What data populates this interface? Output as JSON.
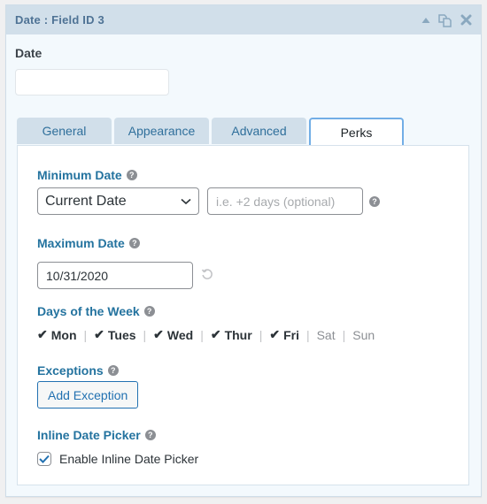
{
  "header": {
    "title": "Date : Field ID 3",
    "icons": [
      "collapse-triangle-icon",
      "duplicate-icon",
      "close-icon"
    ]
  },
  "field": {
    "label": "Date",
    "preview_value": ""
  },
  "tabs": [
    {
      "label": "General",
      "active": false
    },
    {
      "label": "Appearance",
      "active": false
    },
    {
      "label": "Advanced",
      "active": false
    },
    {
      "label": "Perks",
      "active": true
    }
  ],
  "perks": {
    "minimum_date": {
      "label": "Minimum Date",
      "select_value": "Current Date",
      "offset_value": "",
      "offset_placeholder": "i.e. +2 days (optional)"
    },
    "maximum_date": {
      "label": "Maximum Date",
      "value": "10/31/2020"
    },
    "days_of_week": {
      "label": "Days of the Week",
      "days": [
        {
          "label": "Mon",
          "enabled": true
        },
        {
          "label": "Tues",
          "enabled": true
        },
        {
          "label": "Wed",
          "enabled": true
        },
        {
          "label": "Thur",
          "enabled": true
        },
        {
          "label": "Fri",
          "enabled": true
        },
        {
          "label": "Sat",
          "enabled": false
        },
        {
          "label": "Sun",
          "enabled": false
        }
      ]
    },
    "exceptions": {
      "label": "Exceptions",
      "button_label": "Add Exception"
    },
    "inline_picker": {
      "label": "Inline Date Picker",
      "checkbox_label": "Enable Inline Date Picker",
      "checked": true
    }
  },
  "colors": {
    "accent": "#2271b1",
    "header_bg": "#d1dfea",
    "tab_active_border": "#72aee6"
  }
}
